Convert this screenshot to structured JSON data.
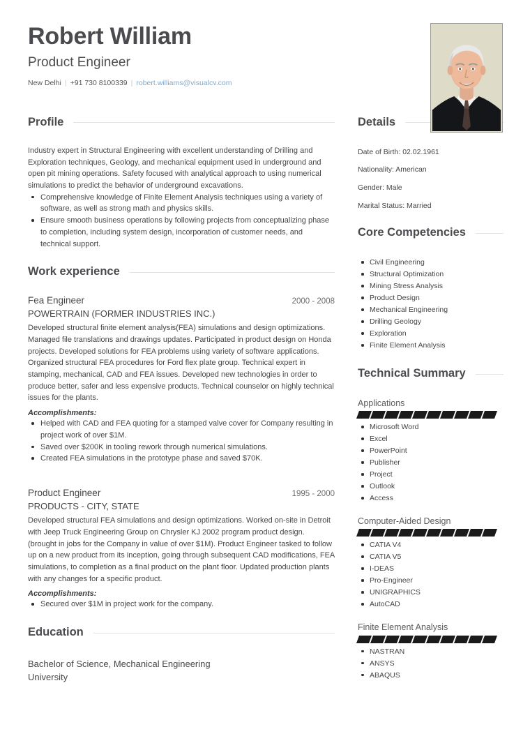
{
  "header": {
    "name": "Robert William",
    "job_title": "Product Engineer",
    "location": "New Delhi",
    "phone": "+91 730 8100339",
    "email": "robert.williams@visualcv.com",
    "separator": "|",
    "photo_alt": "portrait-photo",
    "email_color": "#7fa9cc"
  },
  "profile": {
    "heading": "Profile",
    "summary": "Industry expert in Structural Engineering with excellent understanding of Drilling and Exploration techniques, Geology, and mechanical equipment used in underground and open pit mining operations. Safety focused with analytical approach to using numerical simulations to predict the behavior of underground excavations.",
    "bullets": [
      "Comprehensive knowledge of Finite Element Analysis techniques using a variety of software, as well as strong math and physics skills.",
      "Ensure smooth business operations by following projects from conceptualizing phase to completion, including system design, incorporation of customer needs, and technical support."
    ]
  },
  "work_experience": {
    "heading": "Work experience",
    "accomplishments_label": "Accomplishments:",
    "jobs": [
      {
        "position": "Fea Engineer",
        "dates": "2000 - 2008",
        "organization": "POWERTRAIN (FORMER INDUSTRIES INC.)",
        "description": "Developed structural finite element analysis(FEA) simulations and design optimizations. Managed file translations and drawings updates. Participated in product design on Honda projects. Developed solutions for FEA problems using variety of software applications. Organized structural FEA procedures for Ford flex plate group. Technical expert in stamping, mechanical, CAD and FEA issues. Developed new technologies in order to produce better, safer and less expensive products. Technical counselor on highly technical issues for the plants.",
        "accomplishments": [
          "Helped with CAD and FEA quoting for a stamped valve cover for Company resulting in project work of over $1M.",
          "Saved over $200K in tooling rework through numerical simulations.",
          "Created FEA simulations in the prototype phase and saved $70K."
        ]
      },
      {
        "position": "Product Engineer",
        "dates": "1995 - 2000",
        "organization": "PRODUCTS - CITY, STATE",
        "description": "Developed structural FEA simulations and design optimizations. Worked on-site in Detroit with Jeep Truck Engineering Group on Chrysler KJ 2002 program product design. (brought in jobs for the Company in value of over $1M). Product Engineer tasked to follow up on a new product from its inception, going through subsequent CAD modifications, FEA simulations, to completion as a final product on the plant floor. Updated production plants with any changes for a specific product.",
        "accomplishments": [
          "Secured over $1M in project work for the company."
        ]
      }
    ]
  },
  "education": {
    "heading": "Education",
    "entries": [
      {
        "degree": "Bachelor of Science, Mechanical Engineering",
        "school": "University"
      }
    ]
  },
  "details": {
    "heading": "Details",
    "rows": [
      "Date of Birth: 02.02.1961",
      "Nationality: American",
      "Gender: Male",
      "Marital Status: Married"
    ]
  },
  "core_competencies": {
    "heading": "Core Competencies",
    "items": [
      "Civil Engineering",
      "Structural Optimization",
      "Mining Stress Analysis",
      "Product Design",
      "Mechanical Engineering",
      "Drilling Geology",
      "Exploration",
      "Finite Element Analysis"
    ]
  },
  "technical_summary": {
    "heading": "Technical Summary",
    "groups": [
      {
        "name": "Applications",
        "level_segments": 10,
        "filled_segments": 10,
        "items": [
          "Microsoft Word",
          "Excel",
          "PowerPoint",
          "Publisher",
          "Project",
          "Outlook",
          "Access"
        ]
      },
      {
        "name": "Computer-Aided Design",
        "level_segments": 10,
        "filled_segments": 10,
        "items": [
          "CATIA V4",
          "CATIA V5",
          "I-DEAS",
          "Pro-Engineer",
          "UNIGRAPHICS",
          "AutoCAD"
        ]
      },
      {
        "name": "Finite Element Analysis",
        "level_segments": 10,
        "filled_segments": 10,
        "items": [
          "NASTRAN",
          "ANSYS",
          "ABAQUS"
        ]
      }
    ]
  }
}
